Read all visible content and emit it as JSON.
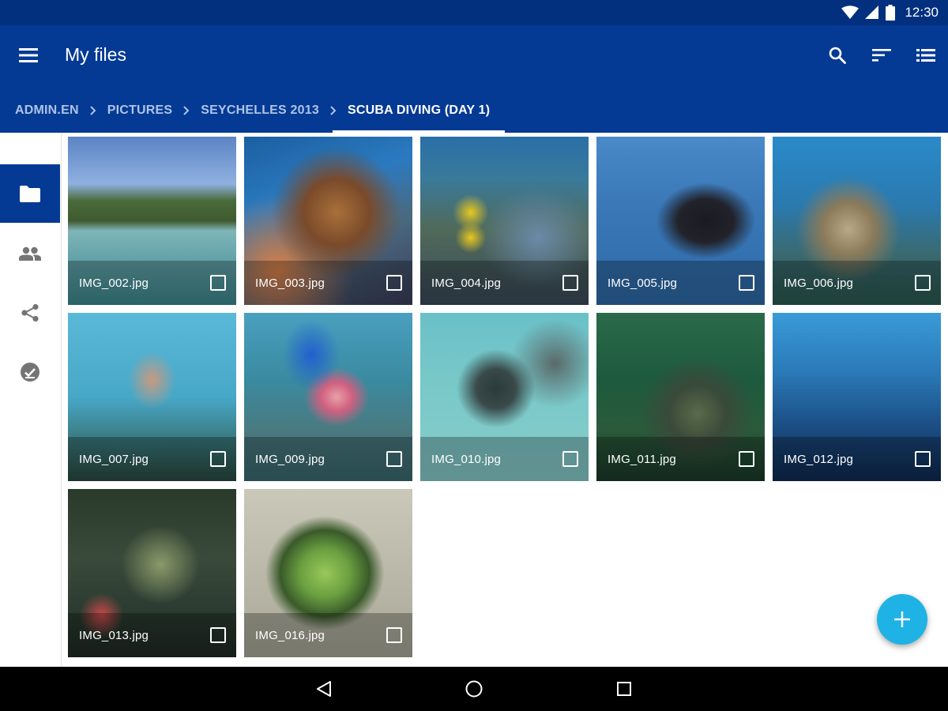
{
  "status_bar": {
    "time": "12:30",
    "icons": [
      "wifi-icon",
      "cell-signal-icon",
      "battery-icon"
    ]
  },
  "app_bar": {
    "title": "My files",
    "actions": [
      "search-icon",
      "sort-icon",
      "list-view-icon"
    ],
    "background": "#043a94"
  },
  "breadcrumb": {
    "items": [
      "ADMIN.EN",
      "PICTURES",
      "SEYCHELLES 2013"
    ],
    "active": "SCUBA DIVING (DAY 1)"
  },
  "side_rail": {
    "items": [
      "folder-icon",
      "people-icon",
      "share-icon",
      "offline-icon"
    ],
    "active_index": 0
  },
  "files": [
    {
      "name": "IMG_002.jpg"
    },
    {
      "name": "IMG_003.jpg"
    },
    {
      "name": "IMG_004.jpg"
    },
    {
      "name": "IMG_005.jpg"
    },
    {
      "name": "IMG_006.jpg"
    },
    {
      "name": "IMG_007.jpg"
    },
    {
      "name": "IMG_009.jpg"
    },
    {
      "name": "IMG_010.jpg"
    },
    {
      "name": "IMG_011.jpg"
    },
    {
      "name": "IMG_012.jpg"
    },
    {
      "name": "IMG_013.jpg"
    },
    {
      "name": "IMG_016.jpg"
    }
  ],
  "fab": {
    "icon": "add-icon",
    "color": "#1fb3e5"
  },
  "nav_bar": {
    "buttons": [
      "back-icon",
      "home-icon",
      "recents-icon"
    ]
  }
}
